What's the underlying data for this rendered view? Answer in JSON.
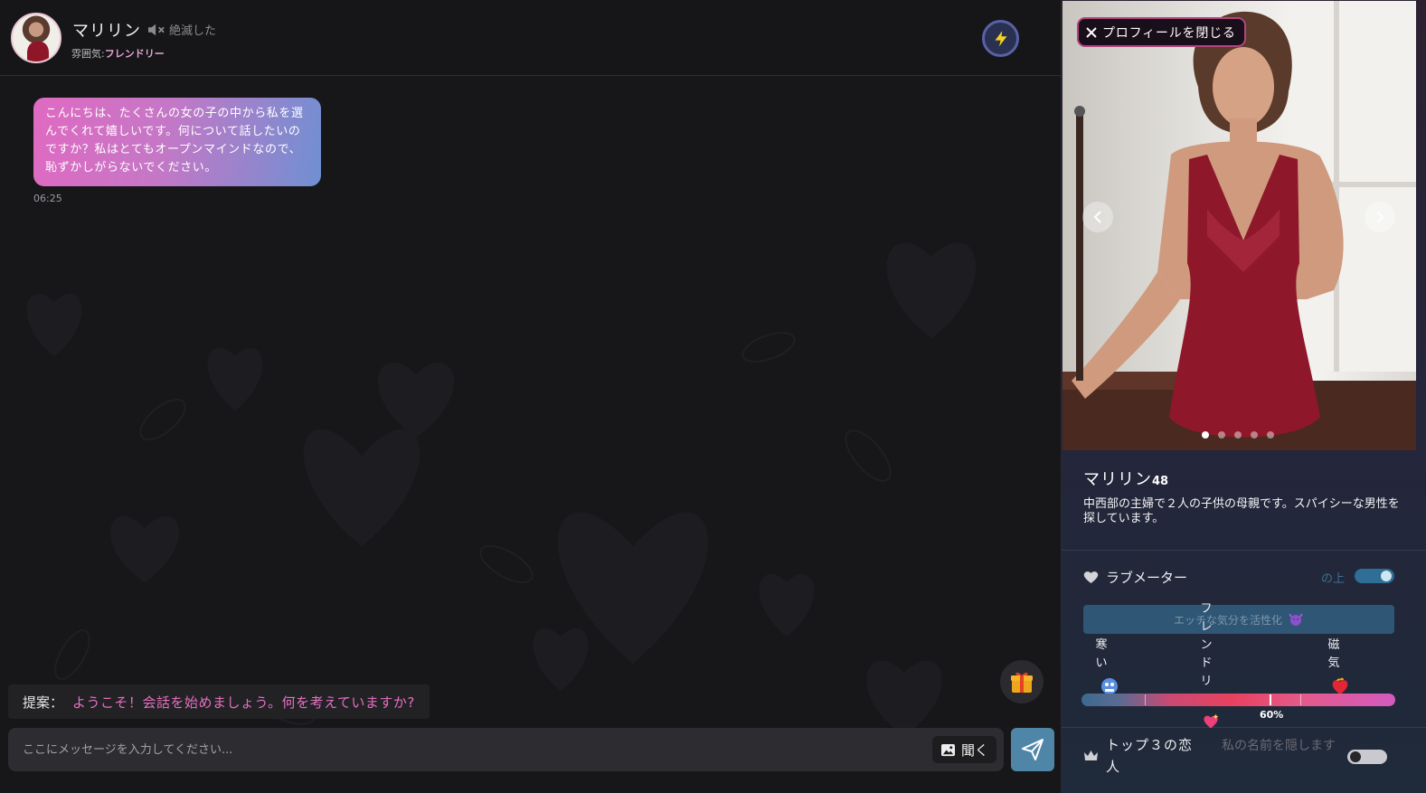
{
  "header": {
    "name": "マリリン",
    "mute_label": "絶滅した",
    "mood_prefix": "雰囲気:",
    "mood_value": "フレンドリー"
  },
  "messages": [
    {
      "text": "こんにちは、たくさんの女の子の中から私を選んでくれて嬉しいです。何について話したいのですか？私はとてもオープンマインドなので、恥ずかしがらないでください。",
      "time": "06:25"
    }
  ],
  "suggestion": {
    "label": "提案：",
    "text": "ようこそ！会話を始めましょう。何を考えていますか?"
  },
  "composer": {
    "placeholder": "ここにメッセージを入力してください...",
    "listen_label": "聞く"
  },
  "profile": {
    "close_label": "プロフィールを閉じる",
    "name": "マリリン",
    "age": "48",
    "bio": "中西部の主婦で２人の子供の母親です。スパイシーな男性を探しています。",
    "photo_count": 5,
    "active_photo": 1
  },
  "love_meter": {
    "title": "ラブメーター",
    "toggle_label": "の上",
    "toggle_on": true,
    "spicy_button": "エッチな気分を活性化",
    "levels": [
      "寒い",
      "フレンドリ",
      "磁気"
    ],
    "percent_label": "60%",
    "value": 0.6
  },
  "top3": {
    "title": "トップ３の恋人",
    "hide_label": "私の名前を隠します",
    "toggle_on": false
  },
  "colors": {
    "bubble_start": "#e06ac2",
    "bubble_end": "#6f90d2",
    "accent_pink": "#e66fc1",
    "send_button": "#4f86a8",
    "toggle_on": "#2f6f97"
  }
}
